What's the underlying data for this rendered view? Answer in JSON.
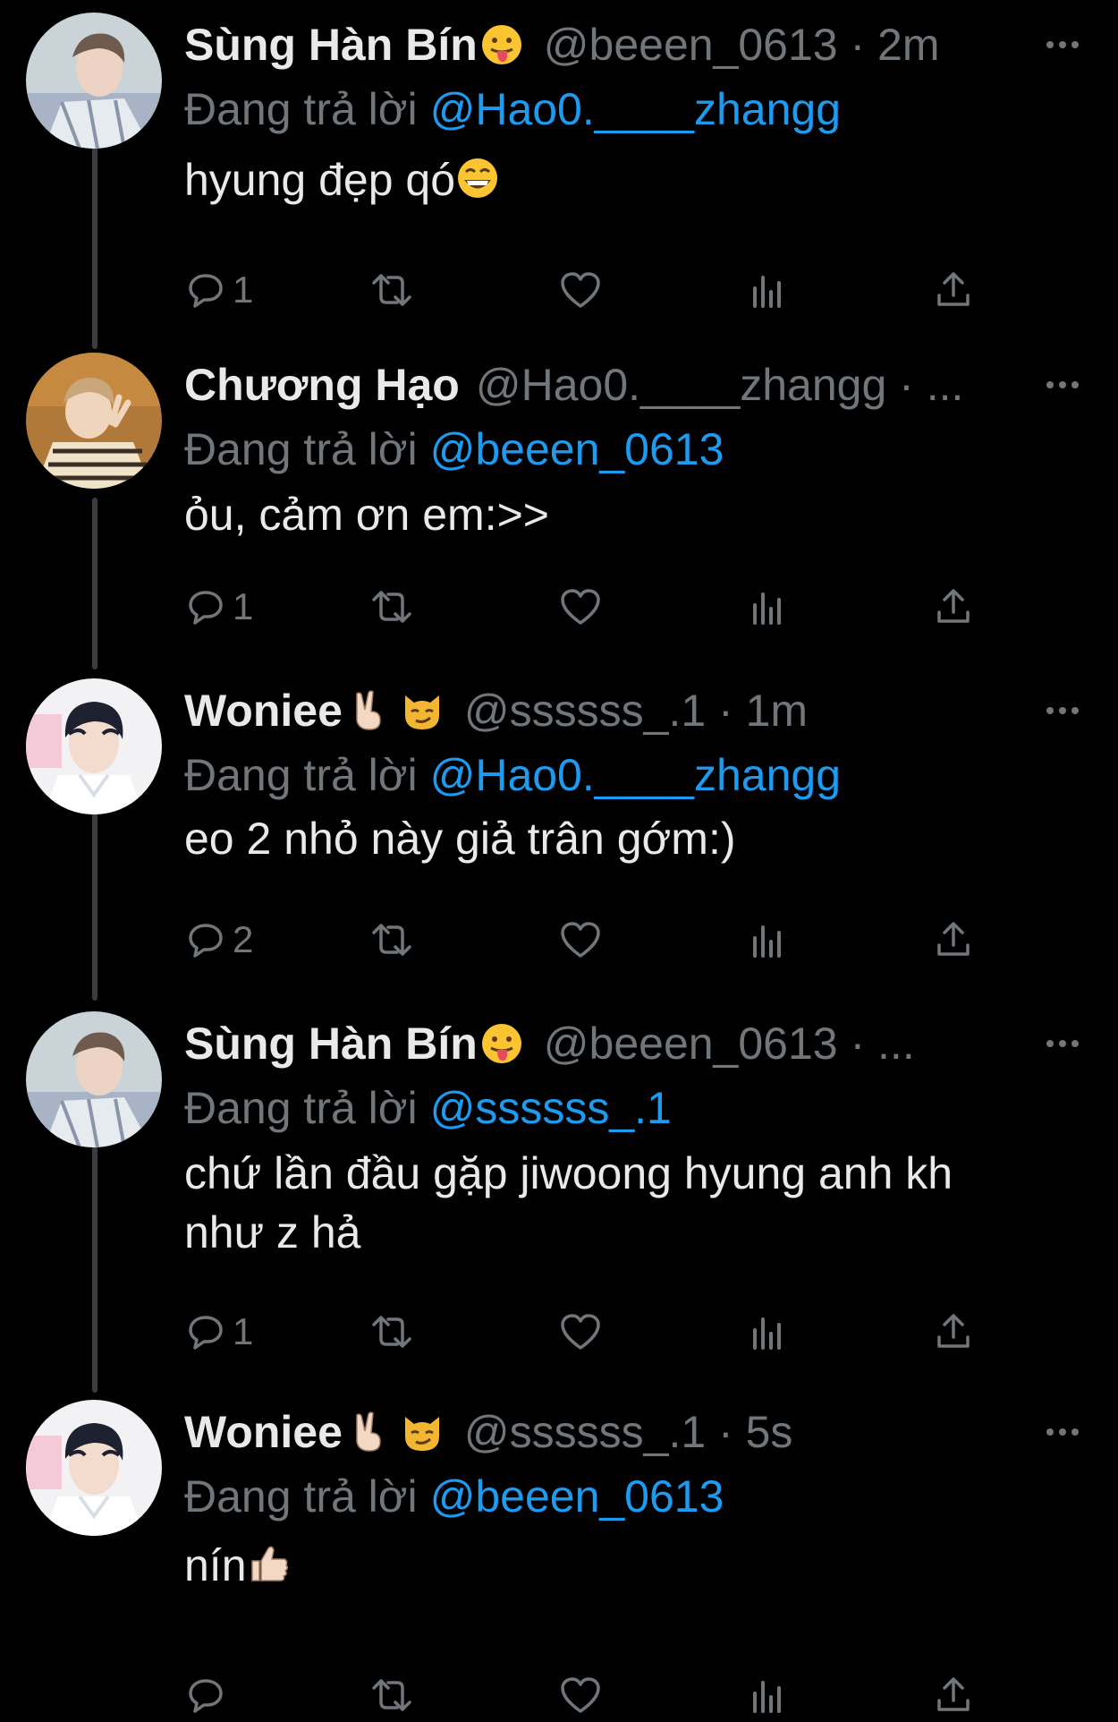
{
  "reply_prefix": "Đang trả lời",
  "colors": {
    "background": "#000000",
    "text": "#e7e9ea",
    "secondary": "#71767b",
    "accent": "#1d9bf0",
    "thread_line": "#3a3d40"
  },
  "tweets": [
    {
      "display_name": "Sùng Hàn Bín",
      "name_emojis": [
        "face-with-tongue-emoji"
      ],
      "handle_meta": "@beeen_0613 · 2m",
      "reply_to": "@Hao0.____zhangg",
      "text": "hyung đẹp qó",
      "text_emojis": [
        "grinning-face-emoji"
      ],
      "reply_count": "1"
    },
    {
      "display_name": "Chương Hạo",
      "name_emojis": [],
      "handle_meta": "@Hao0.____zhangg · ...",
      "reply_to": "@beeen_0613",
      "text": "ỏu, cảm ơn em:>>",
      "text_emojis": [],
      "reply_count": "1"
    },
    {
      "display_name": "Woniee",
      "name_emojis": [
        "victory-hand-emoji",
        "smirking-cat-emoji"
      ],
      "handle_meta": "@ssssss_.1 · 1m",
      "reply_to": "@Hao0.____zhangg",
      "text": "eo 2 nhỏ này giả trân gớm:)",
      "text_emojis": [],
      "reply_count": "2"
    },
    {
      "display_name": "Sùng Hàn Bín",
      "name_emojis": [
        "face-with-tongue-emoji"
      ],
      "handle_meta": "@beeen_0613 · ...",
      "reply_to": "@ssssss_.1",
      "text": "chứ lần đầu gặp jiwoong hyung anh kh\nnhư z hả",
      "text_emojis": [],
      "reply_count": "1"
    },
    {
      "display_name": "Woniee",
      "name_emojis": [
        "victory-hand-emoji",
        "smirking-cat-emoji"
      ],
      "handle_meta": "@ssssss_.1 · 5s",
      "reply_to": "@beeen_0613",
      "text": "nín",
      "text_emojis": [
        "thumbs-up-emoji"
      ],
      "reply_count": ""
    }
  ]
}
